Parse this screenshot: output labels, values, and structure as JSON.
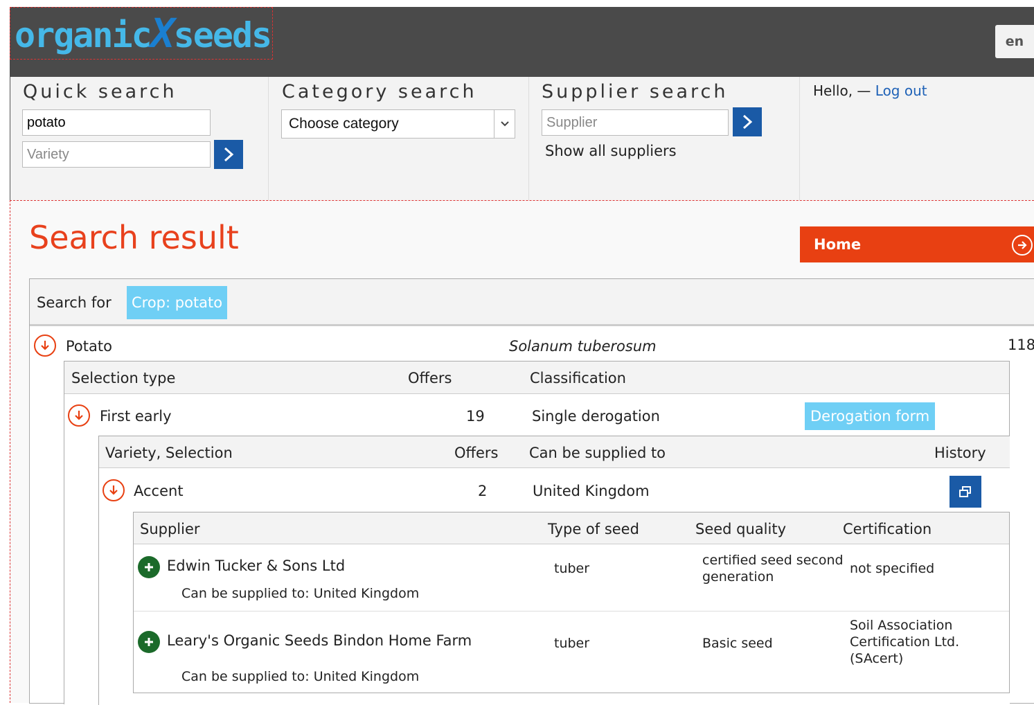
{
  "header": {
    "logo_part1": "organic",
    "logo_x": "X",
    "logo_part2": "seeds",
    "lang": "en"
  },
  "quick_search": {
    "title": "Quick search",
    "crop_value": "potato",
    "variety_placeholder": "Variety"
  },
  "category_search": {
    "title": "Category search",
    "selected": "Choose category"
  },
  "supplier_search": {
    "title": "Supplier search",
    "placeholder": "Supplier",
    "show_all": "Show all suppliers"
  },
  "user": {
    "hello": "Hello, —",
    "logout": "Log out"
  },
  "main": {
    "title": "Search result",
    "home": "Home",
    "search_for_label": "Search for",
    "search_tag": "Crop: potato"
  },
  "crop": {
    "name": "Potato",
    "latin": "Solanum tuberosum",
    "count": "118"
  },
  "selection_table": {
    "headers": [
      "Selection type",
      "Offers",
      "Classification"
    ],
    "row": {
      "type": "First early",
      "offers": "19",
      "classification": "Single derogation",
      "derogation_form": "Derogation form"
    }
  },
  "variety_table": {
    "headers": [
      "Variety, Selection",
      "Offers",
      "Can be supplied to",
      "History"
    ],
    "row": {
      "variety": "Accent",
      "offers": "2",
      "supplied_to": "United Kingdom"
    }
  },
  "supplier_table": {
    "headers": [
      "Supplier",
      "Type of seed",
      "Seed quality",
      "Certification"
    ],
    "rows": [
      {
        "supplier": "Edwin Tucker & Sons Ltd",
        "type": "tuber",
        "quality": "certified seed second generation",
        "certification": "not specified",
        "supplied_to": "Can be supplied to: United Kingdom"
      },
      {
        "supplier": "Leary's Organic Seeds Bindon Home Farm",
        "type": "tuber",
        "quality": "Basic seed",
        "certification": "Soil Association Certification Ltd. (SAcert)",
        "supplied_to": "Can be supplied to: United Kingdom"
      }
    ]
  }
}
